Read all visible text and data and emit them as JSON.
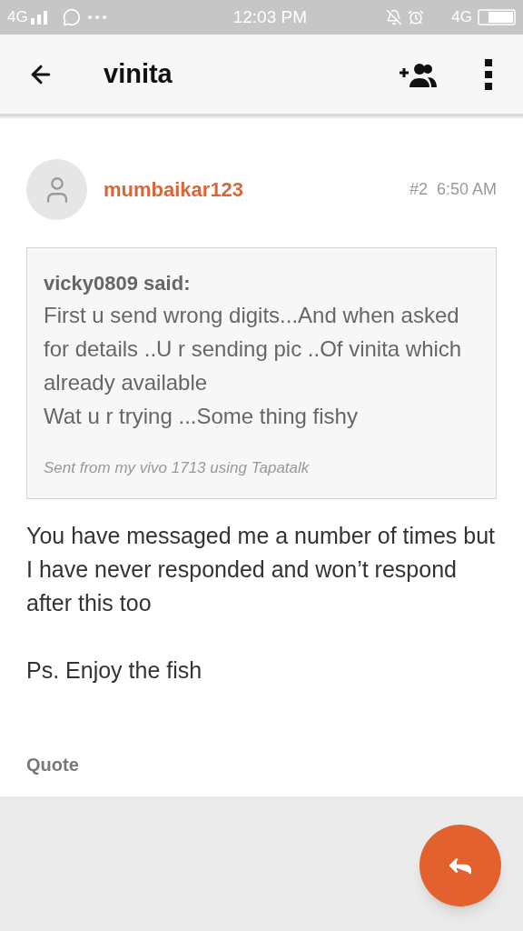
{
  "status_bar": {
    "network": "4G",
    "time": "12:03 PM",
    "data": "4G"
  },
  "header": {
    "title": "vinita"
  },
  "post": {
    "author": "mumbaikar123",
    "number": "#2",
    "time": "6:50 AM",
    "quote": {
      "author": "vicky0809 said:",
      "paragraphs": [
        "First u send wrong digits...And when asked for details ..U r sending pic ..Of vinita which already available",
        "Wat u r trying ...Some thing fishy"
      ],
      "signature": "Sent from my vivo 1713 using Tapatalk"
    },
    "paragraphs": [
      "You have messaged me a number of times but I have never responded and won’t respond after this too",
      "Ps. Enjoy the fish"
    ],
    "quote_link": "Quote"
  }
}
